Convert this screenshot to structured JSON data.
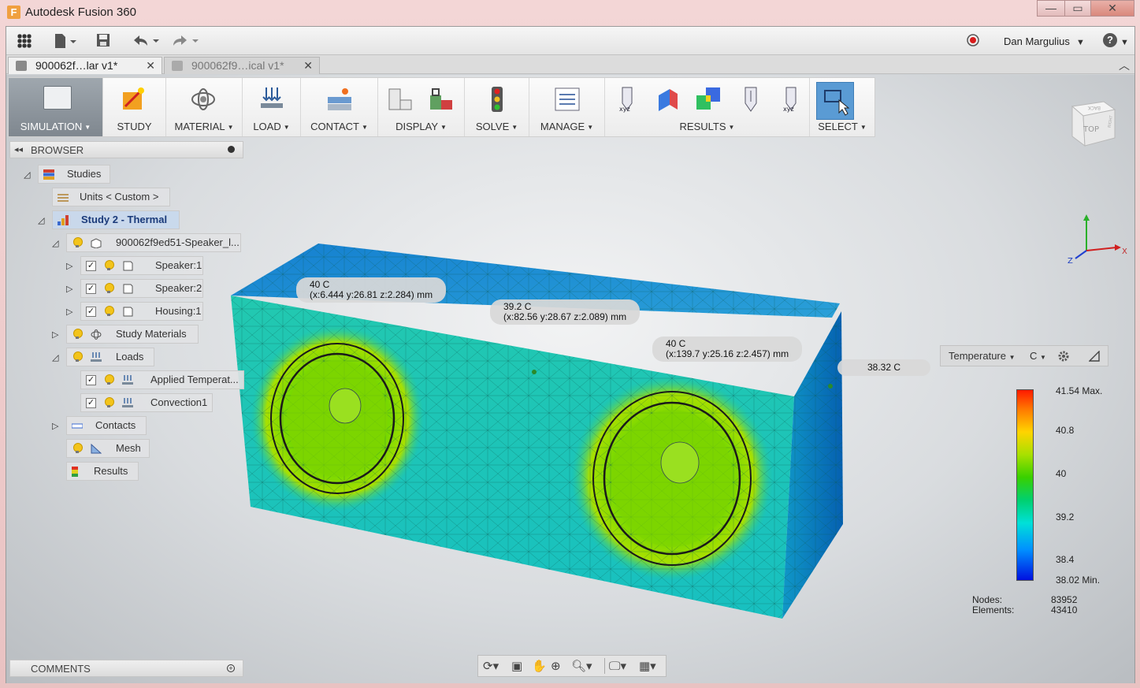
{
  "window": {
    "title": "Autodesk Fusion 360",
    "minimize": "—",
    "restore": "▭",
    "close": "✕"
  },
  "qat": {
    "user": "Dan Margulius",
    "help": "?"
  },
  "tabs": [
    {
      "label": "900062f…lar v1*",
      "close": "✕",
      "active": true
    },
    {
      "label": "900062f9…ical v1*",
      "close": "✕",
      "active": false
    }
  ],
  "toolbar": {
    "workspace": "SIMULATION",
    "groups": [
      "STUDY",
      "MATERIAL",
      "LOAD",
      "CONTACT",
      "DISPLAY",
      "SOLVE",
      "MANAGE",
      "RESULTS",
      "SELECT"
    ]
  },
  "browser": {
    "title": "BROWSER",
    "nodes": [
      {
        "label": "Studies"
      },
      {
        "label": "Units < Custom >"
      },
      {
        "label": "Study 2 - Thermal"
      },
      {
        "label": "900062f9ed51-Speaker_l..."
      },
      {
        "label": "Speaker:1"
      },
      {
        "label": "Speaker:2"
      },
      {
        "label": "Housing:1"
      },
      {
        "label": "Study Materials"
      },
      {
        "label": "Loads"
      },
      {
        "label": "Applied Temperat..."
      },
      {
        "label": "Convection1"
      },
      {
        "label": "Contacts"
      },
      {
        "label": "Mesh"
      },
      {
        "label": "Results"
      }
    ]
  },
  "comments": {
    "title": "COMMENTS"
  },
  "probes": [
    {
      "value": "40 C",
      "coords": "(x:6.444 y:26.81 z:2.284) mm"
    },
    {
      "value": "39.2 C",
      "coords": "(x:82.56 y:28.67 z:2.089) mm"
    },
    {
      "value": "40 C",
      "coords": "(x:139.7 y:25.16 z:2.457) mm"
    },
    {
      "value": "38.32 C"
    }
  ],
  "legend": {
    "quantity": "Temperature",
    "unit": "C",
    "max": "41.54 Max.",
    "ticks": [
      "40.8",
      "40",
      "39.2",
      "38.4"
    ],
    "min": "38.02 Min.",
    "colors": [
      "#ff1a00",
      "#ffd400",
      "#38d000",
      "#00e0d8",
      "#0010e0"
    ]
  },
  "stats": {
    "nodes_label": "Nodes:",
    "nodes": "83952",
    "elements_label": "Elements:",
    "elements": "43410"
  },
  "viewcube": {
    "face": "TOP",
    "back": "BACK",
    "side": "RIGHT"
  },
  "axes": {
    "x": "X",
    "z": "Z"
  }
}
